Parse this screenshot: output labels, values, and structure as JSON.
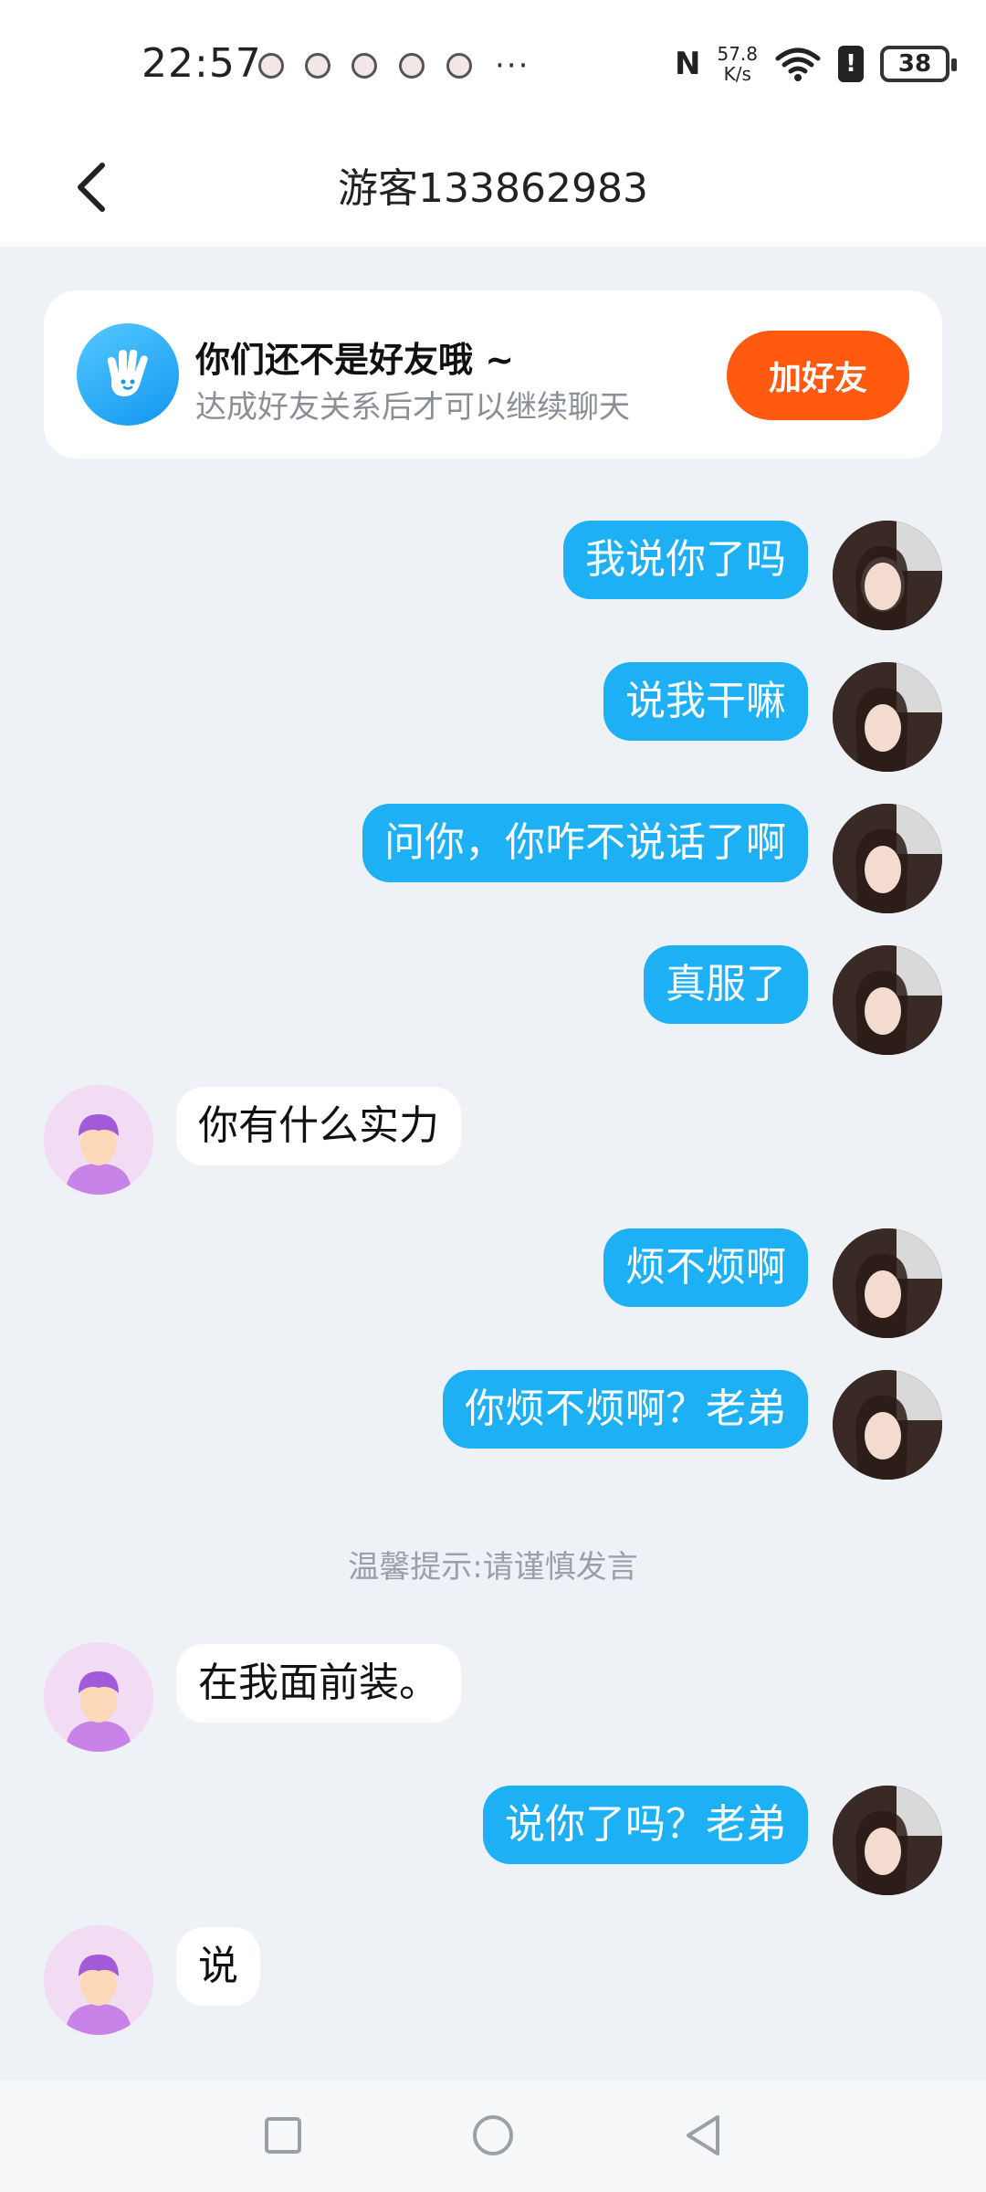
{
  "status_bar": {
    "time": "22:57",
    "net_speed_value": "57.8",
    "net_speed_unit": "K/s",
    "battery": "38",
    "icons": [
      "nfc-icon",
      "wifi-icon",
      "alert-icon",
      "battery-icon"
    ]
  },
  "header": {
    "title": "游客133862983",
    "back_icon": "chevron-left-icon"
  },
  "friend_banner": {
    "title": "你们还不是好友哦 ~",
    "subtitle": "达成好友关系后才可以继续聊天",
    "button": "加好友",
    "accent": "#ff5a10"
  },
  "messages": [
    {
      "from": "me",
      "text": "我说你了吗"
    },
    {
      "from": "me",
      "text": "说我干嘛"
    },
    {
      "from": "me",
      "text": "问你，你咋不说话了啊"
    },
    {
      "from": "me",
      "text": "真服了"
    },
    {
      "from": "other",
      "text": "你有什么实力"
    },
    {
      "from": "me",
      "text": "烦不烦啊"
    },
    {
      "from": "me",
      "text": "你烦不烦啊？老弟"
    },
    {
      "from": "other",
      "text": "在我面前装。"
    },
    {
      "from": "me",
      "text": "说你了吗？老弟"
    },
    {
      "from": "other",
      "text": "说"
    }
  ],
  "tip": "温馨提示:请谨慎发言",
  "colors": {
    "bubble_out": "#1eb0f5",
    "bubble_in": "#ffffff",
    "background": "#eef1f5"
  },
  "nav_bar": {
    "icons": [
      "recent-apps-icon",
      "home-icon",
      "back-icon"
    ]
  }
}
